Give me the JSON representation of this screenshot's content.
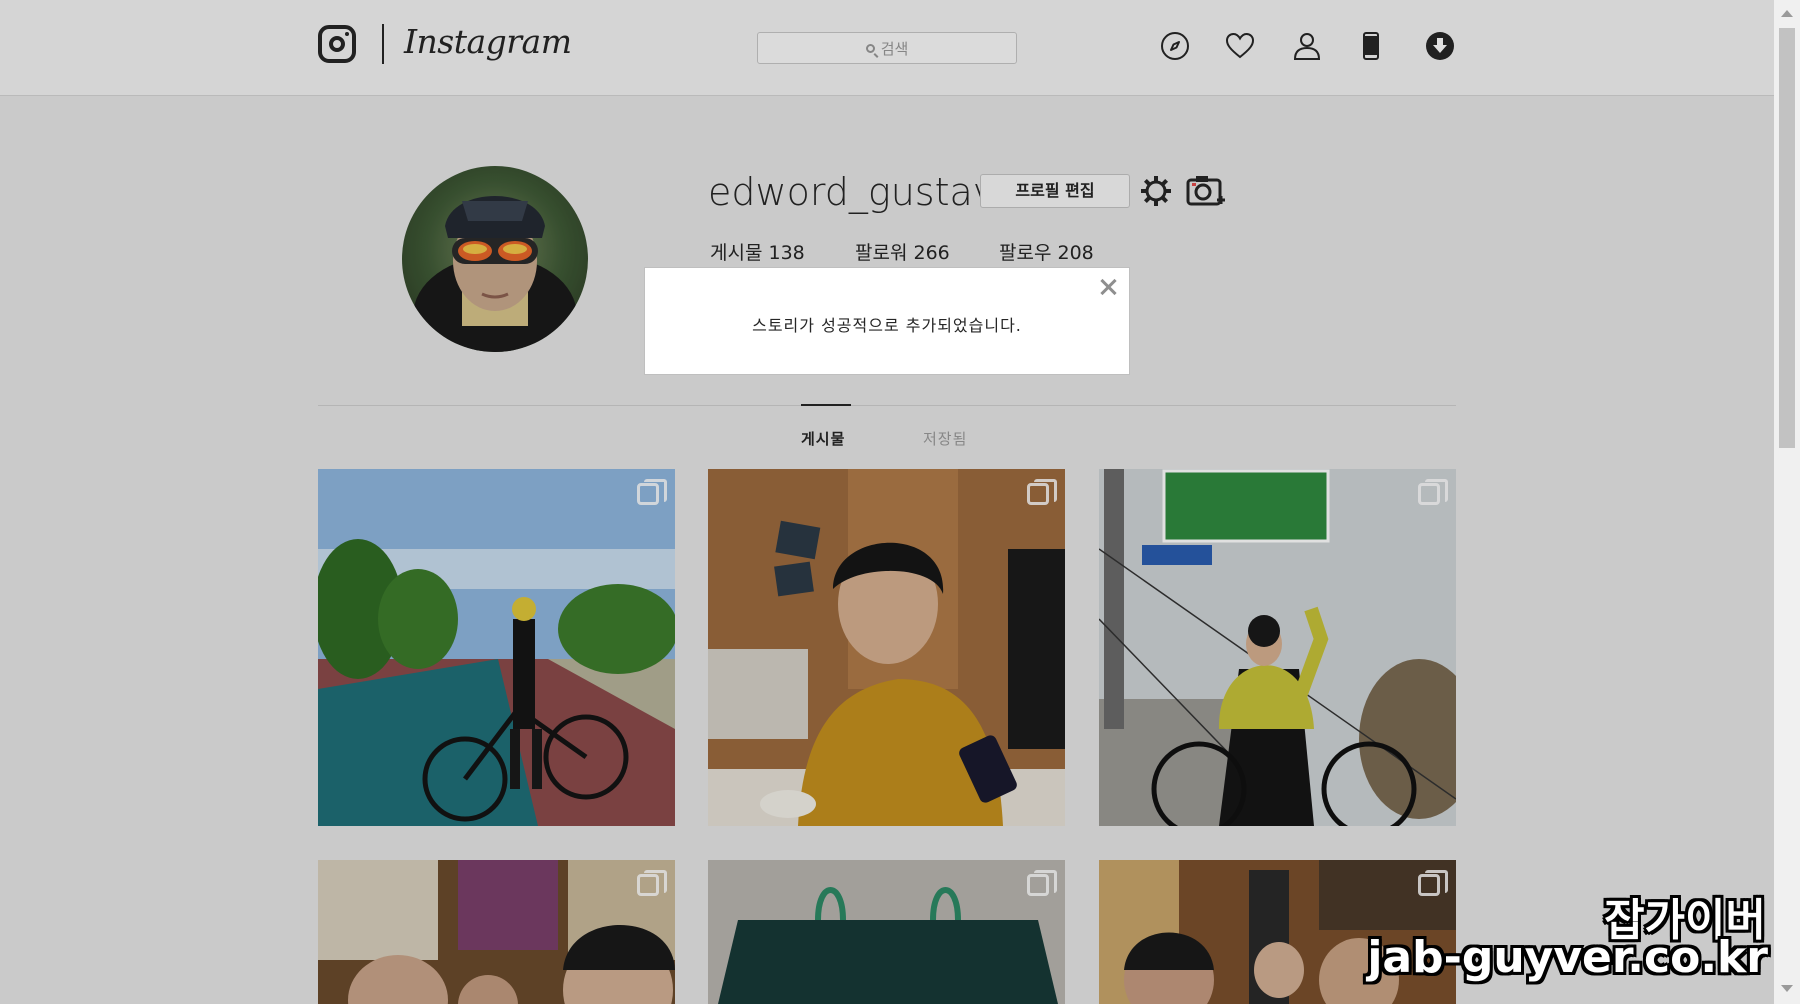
{
  "header": {
    "brand": "Instagram",
    "search_placeholder": "검색",
    "icons": [
      "compass-icon",
      "heart-icon",
      "person-icon",
      "phone-icon",
      "download-icon"
    ]
  },
  "profile": {
    "username": "edword_gustav",
    "edit_button": "프로필 편집",
    "stats": {
      "posts": "게시물 138",
      "followers": "팔로워 266",
      "following": "팔로우 208"
    }
  },
  "tabs": [
    {
      "label": "게시물",
      "active": true
    },
    {
      "label": "저장됨",
      "active": false
    }
  ],
  "modal": {
    "message": "스토리가 성공적으로 추가되었습니다."
  },
  "watermark": {
    "korean": "잡가이버",
    "url": "jab-guyver.co.kr"
  },
  "colors": {
    "text": "#262626",
    "muted": "#9a9a9a",
    "background": "#e6e6e6"
  }
}
